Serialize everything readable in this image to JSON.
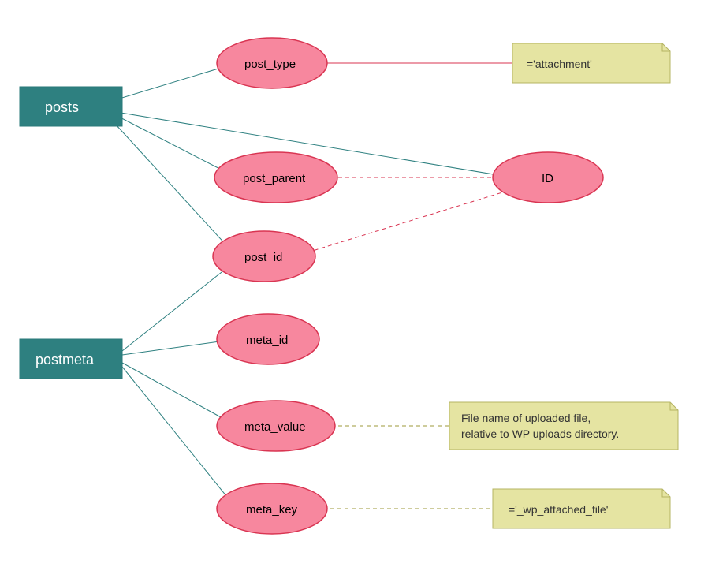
{
  "entities": {
    "posts": {
      "label": "posts"
    },
    "postmeta": {
      "label": "postmeta"
    }
  },
  "attributes": {
    "post_type": {
      "label": "post_type"
    },
    "post_parent": {
      "label": "post_parent"
    },
    "id": {
      "label": "ID"
    },
    "post_id": {
      "label": "post_id"
    },
    "meta_id": {
      "label": "meta_id"
    },
    "meta_value": {
      "label": "meta_value"
    },
    "meta_key": {
      "label": "meta_key"
    }
  },
  "notes": {
    "attachment": {
      "text": "='attachment'"
    },
    "filename_l1": {
      "text": "File name of uploaded file,"
    },
    "filename_l2": {
      "text": "relative to WP uploads directory."
    },
    "wp_attached": {
      "text": "='_wp_attached_file'"
    }
  }
}
